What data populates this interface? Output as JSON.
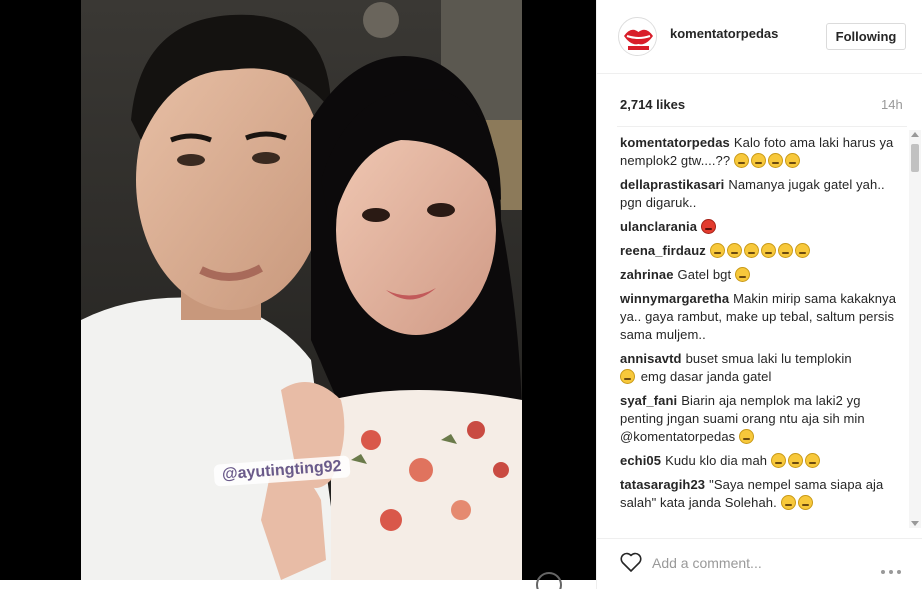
{
  "post": {
    "photo_watermark": "@ayutingting92"
  },
  "header": {
    "username": "komentatorpedas",
    "follow_label": "Following"
  },
  "meta": {
    "likes": "2,714 likes",
    "time": "14h"
  },
  "comments": [
    {
      "user": "komentatorpedas",
      "text": "Kalo foto ama laki harus ya nemplok2 gtw....??",
      "emojis": [
        "yellow",
        "yellow",
        "yellow",
        "yellow"
      ]
    },
    {
      "user": "dellaprastikasari",
      "text": "Namanya jugak gatel yah.. pgn digaruk..",
      "emojis": []
    },
    {
      "user": "ulanclarania",
      "text": "",
      "emojis": [
        "red"
      ]
    },
    {
      "user": "reena_firdauz",
      "text": "",
      "emojis": [
        "yellow",
        "yellow",
        "yellow",
        "yellow",
        "yellow",
        "yellow"
      ]
    },
    {
      "user": "zahrinae",
      "text": "Gatel bgt",
      "emojis": [
        "yellow"
      ]
    },
    {
      "user": "winnymargaretha",
      "text": "Makin mirip sama kakaknya ya.. gaya rambut, make up tebal, saltum persis sama muljem..",
      "emojis": []
    },
    {
      "user": "annisavtd",
      "text": "buset smua laki lu templokin",
      "emojis_mid": [
        "yellow"
      ],
      "text_after": "emg dasar janda gatel",
      "emojis": []
    },
    {
      "user": "syaf_fani",
      "text": "Biarin aja nemplok ma laki2 yg penting jngan suami orang ntu aja sih min @komentatorpedas",
      "emojis": [
        "yellow"
      ]
    },
    {
      "user": "echi05",
      "text": "Kudu klo dia mah",
      "emojis": [
        "yellow",
        "yellow",
        "yellow"
      ]
    },
    {
      "user": "tatasaragih23",
      "text": "\"Saya nempel sama siapa aja salah\" kata janda Solehah.",
      "emojis": [
        "yellow",
        "yellow"
      ]
    }
  ],
  "footer": {
    "comment_placeholder": "Add a comment..."
  },
  "icons": {
    "like": "heart-icon",
    "more": "more-options-icon",
    "avatar": "avatar-lips-logo"
  },
  "colors": {
    "link": "#003569",
    "text": "#262626",
    "muted": "#999999",
    "border": "#efefef"
  }
}
